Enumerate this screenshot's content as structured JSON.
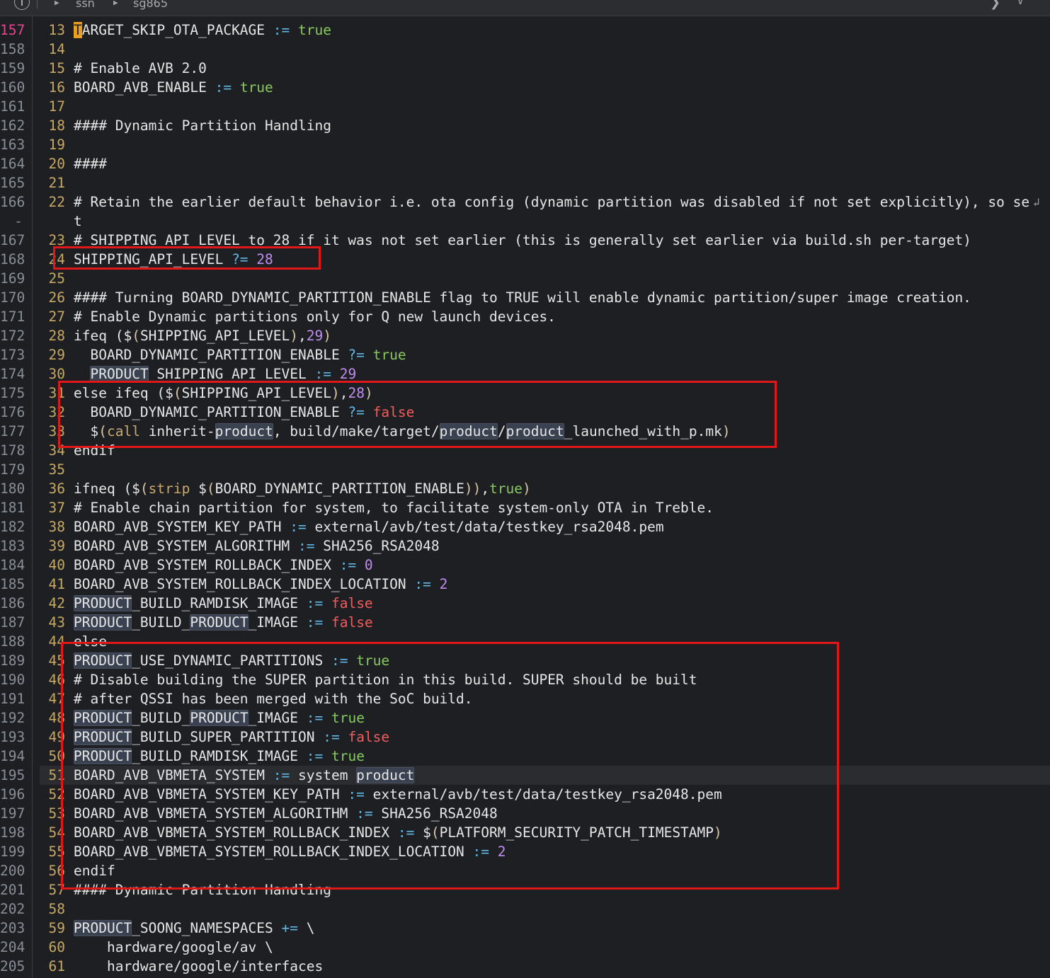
{
  "breadcrumb": {
    "items": [
      "ssn",
      "sg865"
    ]
  },
  "colors": {
    "background": "#1e1f22",
    "keyword_operator": "#5fb8e8",
    "true_value": "#87c95f",
    "false_value": "#f25c5c",
    "number": "#c08df0",
    "highlight_box": "#e21818",
    "current_line_number": "#e5458f"
  },
  "current_line": 195,
  "lines": [
    {
      "abs": "157",
      "rel": "13",
      "text": "TARGET_SKIP_OTA_PACKAGE := true"
    },
    {
      "abs": "158",
      "rel": "14",
      "text": ""
    },
    {
      "abs": "159",
      "rel": "15",
      "text": "# Enable AVB 2.0"
    },
    {
      "abs": "160",
      "rel": "16",
      "text": "BOARD_AVB_ENABLE := true"
    },
    {
      "abs": "161",
      "rel": "17",
      "text": ""
    },
    {
      "abs": "162",
      "rel": "18",
      "text": "#### Dynamic Partition Handling"
    },
    {
      "abs": "163",
      "rel": "19",
      "text": ""
    },
    {
      "abs": "164",
      "rel": "20",
      "text": "####"
    },
    {
      "abs": "165",
      "rel": "21",
      "text": ""
    },
    {
      "abs": "166",
      "rel": "22",
      "text": "# Retain the earlier default behavior i.e. ota config (dynamic partition was disabled if not set explicitly), so se"
    },
    {
      "abs": "-",
      "rel": "",
      "text": "t"
    },
    {
      "abs": "167",
      "rel": "23",
      "text": "# SHIPPING_API_LEVEL to 28 if it was not set earlier (this is generally set earlier via build.sh per-target)"
    },
    {
      "abs": "168",
      "rel": "24",
      "text": "SHIPPING_API_LEVEL ?= 28"
    },
    {
      "abs": "169",
      "rel": "25",
      "text": ""
    },
    {
      "abs": "170",
      "rel": "26",
      "text": "#### Turning BOARD_DYNAMIC_PARTITION_ENABLE flag to TRUE will enable dynamic partition/super image creation."
    },
    {
      "abs": "171",
      "rel": "27",
      "text": "# Enable Dynamic partitions only for Q new launch devices."
    },
    {
      "abs": "172",
      "rel": "28",
      "text": "ifeq ($(SHIPPING_API_LEVEL),29)"
    },
    {
      "abs": "173",
      "rel": "29",
      "text": "  BOARD_DYNAMIC_PARTITION_ENABLE ?= true"
    },
    {
      "abs": "174",
      "rel": "30",
      "text": "  PRODUCT_SHIPPING_API_LEVEL := 29"
    },
    {
      "abs": "175",
      "rel": "31",
      "text": "else ifeq ($(SHIPPING_API_LEVEL),28)"
    },
    {
      "abs": "176",
      "rel": "32",
      "text": "  BOARD_DYNAMIC_PARTITION_ENABLE ?= false"
    },
    {
      "abs": "177",
      "rel": "33",
      "text": "  $(call inherit-product, build/make/target/product/product_launched_with_p.mk)"
    },
    {
      "abs": "178",
      "rel": "34",
      "text": "endif"
    },
    {
      "abs": "179",
      "rel": "35",
      "text": ""
    },
    {
      "abs": "180",
      "rel": "36",
      "text": "ifneq ($(strip $(BOARD_DYNAMIC_PARTITION_ENABLE)),true)"
    },
    {
      "abs": "181",
      "rel": "37",
      "text": "# Enable chain partition for system, to facilitate system-only OTA in Treble."
    },
    {
      "abs": "182",
      "rel": "38",
      "text": "BOARD_AVB_SYSTEM_KEY_PATH := external/avb/test/data/testkey_rsa2048.pem"
    },
    {
      "abs": "183",
      "rel": "39",
      "text": "BOARD_AVB_SYSTEM_ALGORITHM := SHA256_RSA2048"
    },
    {
      "abs": "184",
      "rel": "40",
      "text": "BOARD_AVB_SYSTEM_ROLLBACK_INDEX := 0"
    },
    {
      "abs": "185",
      "rel": "41",
      "text": "BOARD_AVB_SYSTEM_ROLLBACK_INDEX_LOCATION := 2"
    },
    {
      "abs": "186",
      "rel": "42",
      "text": "PRODUCT_BUILD_RAMDISK_IMAGE := false"
    },
    {
      "abs": "187",
      "rel": "43",
      "text": "PRODUCT_BUILD_PRODUCT_IMAGE := false"
    },
    {
      "abs": "188",
      "rel": "44",
      "text": "else"
    },
    {
      "abs": "189",
      "rel": "45",
      "text": "PRODUCT_USE_DYNAMIC_PARTITIONS := true"
    },
    {
      "abs": "190",
      "rel": "46",
      "text": "# Disable building the SUPER partition in this build. SUPER should be built"
    },
    {
      "abs": "191",
      "rel": "47",
      "text": "# after QSSI has been merged with the SoC build."
    },
    {
      "abs": "192",
      "rel": "48",
      "text": "PRODUCT_BUILD_PRODUCT_IMAGE := true"
    },
    {
      "abs": "193",
      "rel": "49",
      "text": "PRODUCT_BUILD_SUPER_PARTITION := false"
    },
    {
      "abs": "194",
      "rel": "50",
      "text": "PRODUCT_BUILD_RAMDISK_IMAGE := true"
    },
    {
      "abs": "195",
      "rel": "51",
      "text": "BOARD_AVB_VBMETA_SYSTEM := system product"
    },
    {
      "abs": "196",
      "rel": "52",
      "text": "BOARD_AVB_VBMETA_SYSTEM_KEY_PATH := external/avb/test/data/testkey_rsa2048.pem"
    },
    {
      "abs": "197",
      "rel": "53",
      "text": "BOARD_AVB_VBMETA_SYSTEM_ALGORITHM := SHA256_RSA2048"
    },
    {
      "abs": "198",
      "rel": "54",
      "text": "BOARD_AVB_VBMETA_SYSTEM_ROLLBACK_INDEX := $(PLATFORM_SECURITY_PATCH_TIMESTAMP)"
    },
    {
      "abs": "199",
      "rel": "55",
      "text": "BOARD_AVB_VBMETA_SYSTEM_ROLLBACK_INDEX_LOCATION := 2"
    },
    {
      "abs": "200",
      "rel": "56",
      "text": "endif"
    },
    {
      "abs": "201",
      "rel": "57",
      "text": "#### Dynamic Partition Handling"
    },
    {
      "abs": "202",
      "rel": "58",
      "text": ""
    },
    {
      "abs": "203",
      "rel": "59",
      "text": "PRODUCT_SOONG_NAMESPACES += \\"
    },
    {
      "abs": "204",
      "rel": "60",
      "text": "    hardware/google/av \\"
    },
    {
      "abs": "205",
      "rel": "61",
      "text": "    hardware/google/interfaces"
    }
  ]
}
